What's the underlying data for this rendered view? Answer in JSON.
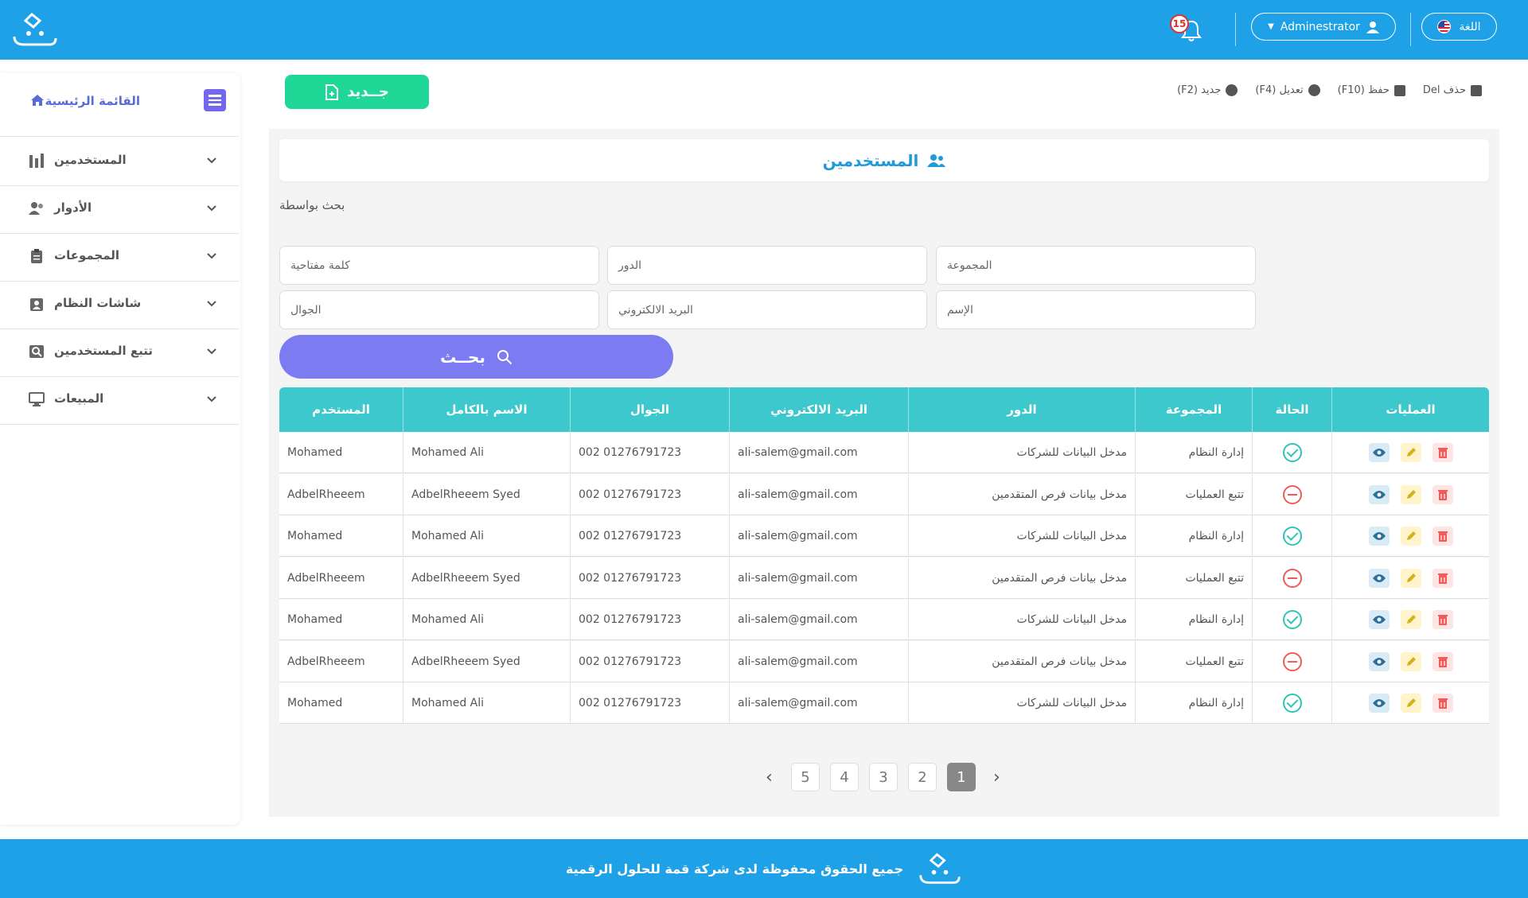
{
  "header": {
    "language_label": "اللغة",
    "user_label": "Adminestrator",
    "notification_count": "15"
  },
  "sidebar": {
    "home_label": "القائمة الرئيسية",
    "items": [
      {
        "label": "المستخدمين",
        "icon": "bar-chart-icon"
      },
      {
        "label": "الأدوار",
        "icon": "users-icon"
      },
      {
        "label": "المجموعات",
        "icon": "clipboard-icon"
      },
      {
        "label": "شاشات النظام",
        "icon": "id-badge-icon"
      },
      {
        "label": "تتبع المستخدمين",
        "icon": "search-box-icon"
      },
      {
        "label": "المبيعات",
        "icon": "monitor-icon"
      }
    ]
  },
  "toolbar": {
    "new_label": "جــديد",
    "shortcuts": {
      "delete": "Del حذف",
      "save": "(F10) حفظ",
      "edit": "(F4) تعديل",
      "new": "(F2) جديد"
    }
  },
  "page": {
    "title": "المستخدمين",
    "search_by": "بحث بواسطة",
    "search_button": "بحــث"
  },
  "filters": {
    "keyword": "كلمة مفتاحية",
    "role": "الدور",
    "group": "المجموعة",
    "mobile": "الجوال",
    "email": "البريد الالكتروني",
    "name": "الإسم"
  },
  "table": {
    "headers": {
      "username": "المستخدم",
      "fullname": "الاسم بالكامل",
      "mobile": "الجوال",
      "email": "البريد الالكتروني",
      "role": "الدور",
      "group": "المجموعة",
      "status": "الحالة",
      "ops": "العمليات"
    },
    "rows": [
      {
        "username": "Mohamed",
        "fullname": "Mohamed Ali",
        "mobile": "002 01276791723",
        "email": "ali-salem@gmail.com",
        "role": "مدخل البيانات للشركات",
        "group": "إدارة النظام",
        "status": "active"
      },
      {
        "username": "AdbelRheeem",
        "fullname": "AdbelRheeem Syed",
        "mobile": "002 01276791723",
        "email": "ali-salem@gmail.com",
        "role": "مدخل بيانات فرص المتقدمين",
        "group": "تتبع العمليات",
        "status": "inactive"
      },
      {
        "username": "Mohamed",
        "fullname": "Mohamed Ali",
        "mobile": "002 01276791723",
        "email": "ali-salem@gmail.com",
        "role": "مدخل البيانات للشركات",
        "group": "إدارة النظام",
        "status": "active"
      },
      {
        "username": "AdbelRheeem",
        "fullname": "AdbelRheeem Syed",
        "mobile": "002 01276791723",
        "email": "ali-salem@gmail.com",
        "role": "مدخل بيانات فرص المتقدمين",
        "group": "تتبع العمليات",
        "status": "inactive"
      },
      {
        "username": "Mohamed",
        "fullname": "Mohamed Ali",
        "mobile": "002 01276791723",
        "email": "ali-salem@gmail.com",
        "role": "مدخل البيانات للشركات",
        "group": "إدارة النظام",
        "status": "active"
      },
      {
        "username": "AdbelRheeem",
        "fullname": "AdbelRheeem Syed",
        "mobile": "002 01276791723",
        "email": "ali-salem@gmail.com",
        "role": "مدخل بيانات فرص المتقدمين",
        "group": "تتبع العمليات",
        "status": "inactive"
      },
      {
        "username": "Mohamed",
        "fullname": "Mohamed Ali",
        "mobile": "002 01276791723",
        "email": "ali-salem@gmail.com",
        "role": "مدخل البيانات للشركات",
        "group": "إدارة النظام",
        "status": "active"
      }
    ]
  },
  "pagination": {
    "pages": [
      "5",
      "4",
      "3",
      "2",
      "1"
    ],
    "current": "1"
  },
  "footer": {
    "text": "جميع الحقوق محفوظة لدى شركة قمة للحلول الرقمية"
  },
  "colors": {
    "header": "#1ea1e6",
    "accent_green": "#1fd897",
    "accent_purple": "#7d7bf1",
    "table_header": "#3cc8cc"
  }
}
